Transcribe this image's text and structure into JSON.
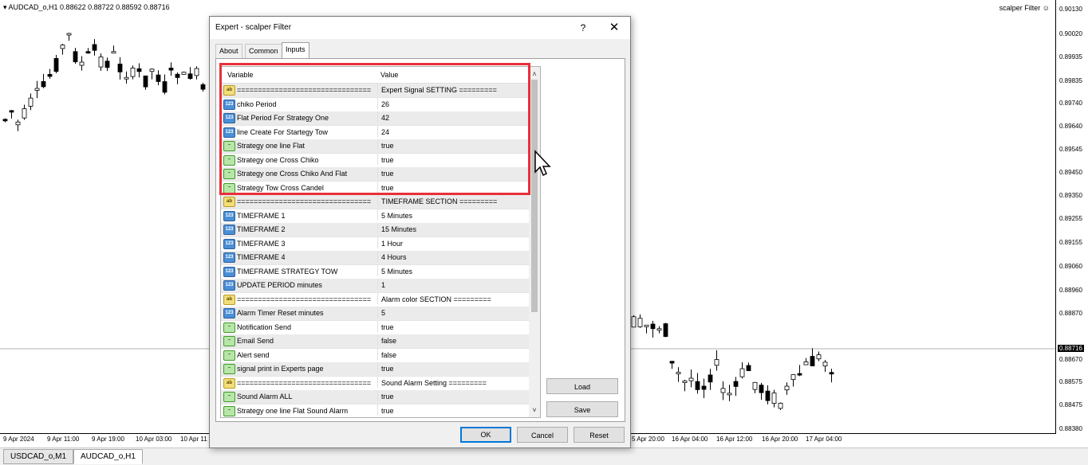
{
  "chart": {
    "symbol_info": "AUDCAD_o,H1  0.88622 0.88722 0.88592 0.88716",
    "ea_label": "scalper Filter",
    "price_labels": [
      "0.90130",
      "0.90020",
      "0.89935",
      "0.89835",
      "0.89740",
      "0.89640",
      "0.89545",
      "0.89450",
      "0.89350",
      "0.89255",
      "0.89155",
      "0.89060",
      "0.88960",
      "0.88870",
      "0.88716",
      "0.88670",
      "0.88575",
      "0.88475",
      "0.88380"
    ],
    "current_price": "0.88716",
    "time_labels": [
      "9 Apr 2024",
      "9 Apr 11:00",
      "9 Apr 19:00",
      "10 Apr 03:00",
      "10 Apr 11",
      "5 Apr 20:00",
      "16 Apr 04:00",
      "16 Apr 12:00",
      "16 Apr 20:00",
      "17 Apr 04:00"
    ],
    "tabs": [
      "USDCAD_o,M1",
      "AUDCAD_o,H1"
    ],
    "active_tab": 1
  },
  "dialog": {
    "title": "Expert - scalper Filter",
    "help": "?",
    "close": "✕",
    "tabs": [
      "About",
      "Common",
      "Inputs"
    ],
    "active_tab": 2,
    "columns": {
      "variable": "Variable",
      "value": "Value"
    },
    "rows": [
      {
        "type": "ab",
        "variable": "================================",
        "value": "Expert Signal  SETTING ========="
      },
      {
        "type": "num",
        "variable": "chiko Period",
        "value": "26"
      },
      {
        "type": "num",
        "variable": "Flat Period For Strategy One",
        "value": "42"
      },
      {
        "type": "num",
        "variable": "line Create For Startegy Tow",
        "value": "24"
      },
      {
        "type": "bool",
        "variable": "Strategy one line Flat",
        "value": "true"
      },
      {
        "type": "bool",
        "variable": "Strategy one Cross Chiko",
        "value": "true"
      },
      {
        "type": "bool",
        "variable": "Strategy one Cross Chiko And Flat",
        "value": "true"
      },
      {
        "type": "bool",
        "variable": "Strategy Tow Cross Candel",
        "value": "true"
      },
      {
        "type": "ab",
        "variable": "================================",
        "value": "TIMEFRAME SECTION ========="
      },
      {
        "type": "num",
        "variable": "TIMEFRAME 1",
        "value": "5 Minutes"
      },
      {
        "type": "num",
        "variable": "TIMEFRAME 2",
        "value": "15 Minutes"
      },
      {
        "type": "num",
        "variable": "TIMEFRAME 3",
        "value": "1 Hour"
      },
      {
        "type": "num",
        "variable": "TIMEFRAME 4",
        "value": "4 Hours"
      },
      {
        "type": "num",
        "variable": "TIMEFRAME STRATEGY TOW",
        "value": "5 Minutes"
      },
      {
        "type": "num",
        "variable": "UPDATE PERIOD minutes",
        "value": "1"
      },
      {
        "type": "ab",
        "variable": "================================",
        "value": "Alarm color SECTION ========="
      },
      {
        "type": "num",
        "variable": "Alarm Timer Reset minutes",
        "value": "5"
      },
      {
        "type": "bool",
        "variable": "Notification Send",
        "value": "true"
      },
      {
        "type": "bool",
        "variable": "Email Send",
        "value": "false"
      },
      {
        "type": "bool",
        "variable": "Alert send",
        "value": "false"
      },
      {
        "type": "bool",
        "variable": "signal print in Experts page",
        "value": "true"
      },
      {
        "type": "ab",
        "variable": "================================",
        "value": "Sound Alarm Setting ========="
      },
      {
        "type": "bool",
        "variable": "Sound Alarm ALL",
        "value": "true"
      },
      {
        "type": "bool",
        "variable": "Strategy one line Flat Sound Alarm",
        "value": "true"
      }
    ],
    "buttons": {
      "load": "Load",
      "save": "Save",
      "ok": "OK",
      "cancel": "Cancel",
      "reset": "Reset"
    }
  }
}
